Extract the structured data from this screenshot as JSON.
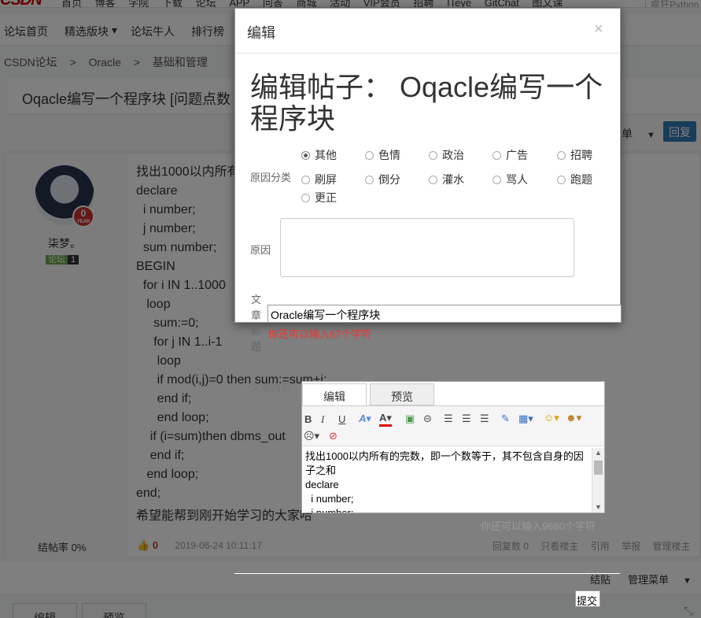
{
  "top_nav": {
    "logo": "CSDN",
    "items": [
      "首页",
      "博客",
      "学院",
      "下载",
      "论坛",
      "APP",
      "问答",
      "商城",
      "活动",
      "VIP会员",
      "招聘",
      "ITeye",
      "GitChat",
      "图文课"
    ],
    "search_placeholder": "疯狂Python"
  },
  "sub_nav": {
    "items": [
      "论坛首页",
      "精选版块",
      "论坛牛人",
      "排行榜"
    ]
  },
  "breadcrumb": [
    "CSDN论坛",
    ">",
    "Oracle",
    ">",
    "基础和管理"
  ],
  "thread": {
    "title": "Oqacle编写一个程序块 [问题点数",
    "menu_label": "单",
    "reply_button": "回复"
  },
  "post": {
    "user": {
      "name": "柒梦。",
      "badge_text": "论坛",
      "level": "1",
      "years": "0",
      "years_unit": "YEAR"
    },
    "close_rate": "结帖率 0%",
    "code": "找出1000以内所有\ndeclare\n  i number;\n  j number;\n  sum number;\nBEGIN\n  for i IN 1..1000\n   loop\n     sum:=0;\n     for j IN 1..i-1\n      loop\n      if mod(i,j)=0 then sum:=sum+i;\n      end if;\n      end loop;\n    if (i=sum)then dbms_out\n    end if;\n   end loop;\nend;",
    "footer_text": "希望能帮到刚开始学习的大家哈",
    "likes": "0",
    "datetime": "2019-06-24 10:11:17",
    "ops": [
      "回复数 0",
      "只看楼主",
      "引用",
      "举报",
      "管理楼主"
    ]
  },
  "bottom_bar": {
    "close_post": "结贴",
    "manage_menu": "管理菜单"
  },
  "bottom_tabs": [
    "编辑",
    "预览"
  ],
  "modal": {
    "header": "编辑",
    "big_title": "编辑帖子： Oqacle编写一个程序块",
    "reason_category_label": "原因分类",
    "reasons": [
      "其他",
      "色情",
      "政治",
      "广告",
      "招聘",
      "刷屏",
      "倒分",
      "灌水",
      "骂人",
      "跑题",
      "更正"
    ],
    "selected_reason": "其他",
    "reason_label": "原因",
    "article_title_label": "文章标题"
  },
  "title_input": {
    "value": "Oracle编写一个程序块"
  },
  "title_remaining": "你还可以输入67个字符",
  "content_label": "文章内容",
  "editor": {
    "tabs": [
      "编辑",
      "预览"
    ],
    "toolbar": [
      "B",
      "I",
      "U"
    ],
    "content": "找出1000以内所有的完数，即一个数等于，其不包含自身的因子之和\ndeclare\n  i number;\n  j number;"
  },
  "chars_remaining": "你还可以输入9680个字符",
  "submit_button": "提交"
}
